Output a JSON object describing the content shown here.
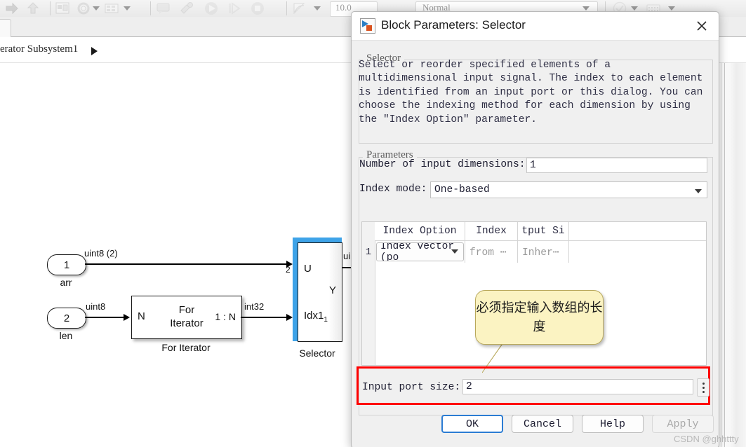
{
  "toolbar": {
    "sim_time": "10.0",
    "sim_mode": "Normal",
    "icons": [
      "forward-arrow-icon",
      "up-arrow-icon",
      "subsystem-icon",
      "gear-icon",
      "chevron-down-icon",
      "table-icon",
      "chevron-down-icon",
      "comment-icon",
      "debug-icon",
      "run-icon",
      "step-forward-icon",
      "stop-icon",
      "chart-icon",
      "chevron-down-icon",
      "check-icon",
      "chevron-down-icon",
      "grid-icon",
      "chevron-down-icon"
    ]
  },
  "breadcrumb": {
    "path": "erator Subsystem1",
    "arrow": "play-arrow-icon"
  },
  "diagram": {
    "inport_arr": {
      "number": "1",
      "label": "arr",
      "signal": "uint8 (2)"
    },
    "inport_len": {
      "number": "2",
      "label": "len",
      "signal": "uint8"
    },
    "for_iterator": {
      "title_line1": "For",
      "title_line2": "Iterator",
      "input_port": "N",
      "output_port": "1 : N",
      "caption": "For Iterator",
      "out_signal": "int32"
    },
    "selector": {
      "port_u": "U",
      "port_idx": "Idx1",
      "port_idx_sub": "1",
      "port_y": "Y",
      "caption": "Selector",
      "u_width": "2",
      "out_signal": "ui"
    }
  },
  "dialog": {
    "icon": "simulink-block-icon",
    "title": "Block Parameters: Selector",
    "close_icon": "close-icon",
    "description_group": {
      "legend": "Selector",
      "text": "Select or reorder specified elements of a multidimensional input signal. The index to each element is identified from an input port or this dialog. You can choose the indexing method for each dimension by using the \"Index Option\" parameter."
    },
    "parameters_group": {
      "legend": "Parameters",
      "num_dims_label": "Number of input dimensions:",
      "num_dims_value": "1",
      "index_mode_label": "Index mode:",
      "index_mode_value": "One-based",
      "index_mode_caret": "chevron-down-icon"
    },
    "table": {
      "headers": [
        "Index Option",
        "Index",
        "tput Si"
      ],
      "rows": [
        {
          "num": "1",
          "index_option": "Index vector (po",
          "index_option_caret": "chevron-down-icon",
          "index": "from ⋯",
          "output_size": "Inher⋯"
        }
      ]
    },
    "input_port_size": {
      "label": "Input port size:",
      "value": "2",
      "more_icon": "vertical-dots-icon"
    },
    "callout": {
      "text": "必须指定输入数组的长度"
    },
    "buttons": {
      "ok": "OK",
      "cancel": "Cancel",
      "help": "Help",
      "apply": "Apply"
    }
  },
  "watermark": "CSDN @ghhttty",
  "colors": {
    "highlight_red": "#ff0000",
    "selection_blue": "#3ea3e8",
    "callout_bg": "#fbf3c2",
    "primary_border": "#2b7cd3"
  }
}
